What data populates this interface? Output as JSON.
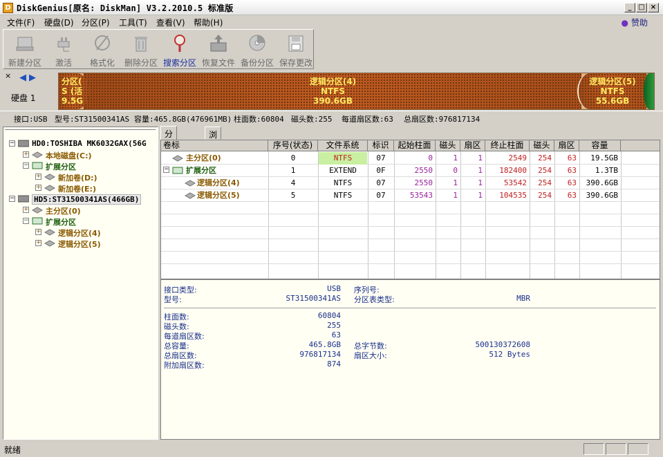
{
  "window": {
    "title": "DiskGenius[原名: DiskMan] V3.2.2010.5 标准版",
    "min": "_",
    "max": "□",
    "close": "×"
  },
  "menu": [
    "文件(F)",
    "硬盘(D)",
    "分区(P)",
    "工具(T)",
    "查看(V)",
    "帮助(H)"
  ],
  "donate": "赞助",
  "toolbar": [
    "新建分区",
    "激活",
    "格式化",
    "删除分区",
    "搜索分区",
    "恢复文件",
    "备份分区",
    "保存更改"
  ],
  "diskmap": {
    "close": "×",
    "disk_label": "硬盘 1",
    "segments": [
      {
        "line1": "分区(",
        "line2": "S (活",
        "line3": "9.5G"
      },
      {
        "line1": "逻辑分区(4)",
        "line2": "NTFS",
        "line3": "390.6GB"
      },
      {
        "line1": "逻辑分区(5)",
        "line2": "NTFS",
        "line3": "55.6GB"
      }
    ]
  },
  "infoline": {
    "iface": "接口:USB",
    "model": "型号:ST31500341AS",
    "capacity": "容量:465.8GB(476961MB)",
    "cylinders": "柱面数:60804",
    "heads": "磁头数:255",
    "sectors_per_track": "每道扇区数:63",
    "total_sectors": "总扇区数:976817134"
  },
  "tree": [
    {
      "text": "HD0:TOSHIBA MK6032GAX(56G",
      "exp": "−"
    },
    {
      "text": "本地磁盘(C:)",
      "exp": "+"
    },
    {
      "text": "扩展分区",
      "exp": "−"
    },
    {
      "text": "新加卷(D:)",
      "exp": "+"
    },
    {
      "text": "新加卷(E:)",
      "exp": "+"
    },
    {
      "text": "HD5:ST31500341AS(466GB)",
      "exp": "−"
    },
    {
      "text": "主分区(0)",
      "exp": "+"
    },
    {
      "text": "扩展分区",
      "exp": "−"
    },
    {
      "text": "逻辑分区(4)",
      "exp": "+"
    },
    {
      "text": "逻辑分区(5)",
      "exp": "+"
    }
  ],
  "tabs": [
    "分区参数",
    "浏览文件"
  ],
  "grid": {
    "headers": [
      "卷标",
      "序号(状态)",
      "文件系统",
      "标识",
      "起始柱面",
      "磁头",
      "扇区",
      "终止柱面",
      "磁头",
      "扇区",
      "容量"
    ],
    "rows": [
      {
        "label": "主分区(0)",
        "exp": "",
        "num": "0",
        "fs": "NTFS",
        "id": "07",
        "sc": "0",
        "sh": "1",
        "ss": "1",
        "ec": "2549",
        "eh": "254",
        "es": "63",
        "cap": "19.5GB"
      },
      {
        "label": "扩展分区",
        "exp": "−",
        "num": "1",
        "fs": "EXTEND",
        "id": "0F",
        "sc": "2550",
        "sh": "0",
        "ss": "1",
        "ec": "182400",
        "eh": "254",
        "es": "63",
        "cap": "1.3TB"
      },
      {
        "label": "逻辑分区(4)",
        "exp": "",
        "num": "4",
        "fs": "NTFS",
        "id": "07",
        "sc": "2550",
        "sh": "1",
        "ss": "1",
        "ec": "53542",
        "eh": "254",
        "es": "63",
        "cap": "390.6GB"
      },
      {
        "label": "逻辑分区(5)",
        "exp": "",
        "num": "5",
        "fs": "NTFS",
        "id": "07",
        "sc": "53543",
        "sh": "1",
        "ss": "1",
        "ec": "104535",
        "eh": "254",
        "es": "63",
        "cap": "390.6GB"
      }
    ]
  },
  "detail": {
    "iface_label": "接口类型:",
    "iface": "USB",
    "serial_label": "序列号:",
    "serial": "",
    "model_label": "型号:",
    "model": "ST31500341AS",
    "ptype_label": "分区表类型:",
    "ptype": "MBR",
    "cyl_label": "柱面数:",
    "cyl": "60804",
    "heads_label": "磁头数:",
    "heads": "255",
    "spt_label": "每道扇区数:",
    "spt": "63",
    "cap_label": "总容量:",
    "cap": "465.8GB",
    "bytes_label": "总字节数:",
    "bytes": "500130372608",
    "secs_label": "总扇区数:",
    "secs": "976817134",
    "secsize_label": "扇区大小:",
    "secsize": "512 Bytes",
    "extra_label": "附加扇区数:",
    "extra": "874"
  },
  "status": "就绪"
}
